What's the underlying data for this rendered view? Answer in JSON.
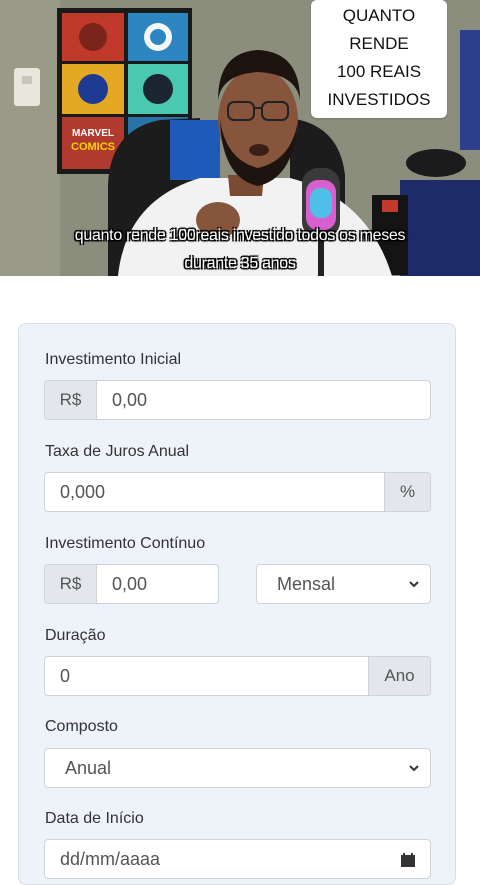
{
  "video": {
    "title_lines": [
      "QUANTO RENDE",
      "100 REAIS",
      "INVESTIDOS"
    ],
    "subtitle_lines": [
      "quanto rende 100reais investido todos os meses",
      "durante 35 anos"
    ],
    "poster_text_1": "MARVEL",
    "poster_text_2": "COMICS"
  },
  "form": {
    "initial_investment": {
      "label": "Investimento Inicial",
      "prefix": "R$",
      "value": "0,00"
    },
    "annual_rate": {
      "label": "Taxa de Juros Anual",
      "value": "0,000",
      "suffix": "%"
    },
    "continuous_investment": {
      "label": "Investimento Contínuo",
      "prefix": "R$",
      "value": "0,00",
      "frequency": "Mensal"
    },
    "duration": {
      "label": "Duração",
      "value": "0",
      "suffix": "Ano"
    },
    "compound": {
      "label": "Composto",
      "value": "Anual"
    },
    "start_date": {
      "label": "Data de Início",
      "value": "dd/mm/aaaa"
    }
  },
  "colors": {
    "panel_bg": "#eef3fa",
    "addon_bg": "#e3e6ea",
    "border": "#ced4da"
  }
}
